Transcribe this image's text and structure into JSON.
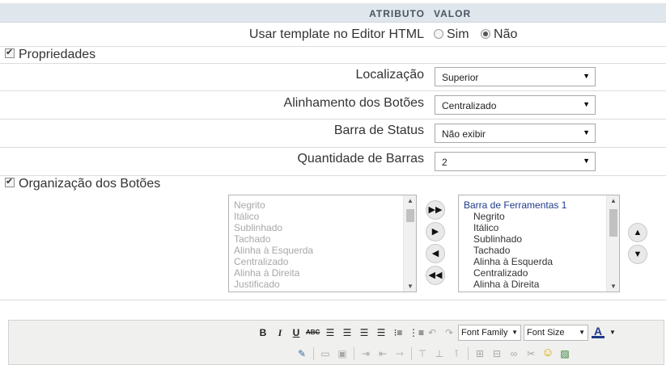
{
  "header": {
    "attr_label": "ATRIBUTO",
    "val_label": "VALOR"
  },
  "template_row": {
    "label": "Usar template no Editor HTML",
    "options": [
      {
        "label": "Sim",
        "selected": false
      },
      {
        "label": "Não",
        "selected": true
      }
    ]
  },
  "section_props": {
    "label": "Propriedades",
    "checked": true
  },
  "props": [
    {
      "label": "Localização",
      "value": "Superior"
    },
    {
      "label": "Alinhamento dos Botões",
      "value": "Centralizado"
    },
    {
      "label": "Barra de Status",
      "value": "Não exibir"
    },
    {
      "label": "Quantidade de Barras",
      "value": "2"
    }
  ],
  "section_org": {
    "label": "Organização dos Botões",
    "checked": true
  },
  "available_list": [
    "Negrito",
    "Itálico",
    "Sublinhado",
    "Tachado",
    "Alinha à Esquerda",
    "Centralizado",
    "Alinha à Direita",
    "Justificado"
  ],
  "selected_list": {
    "header": "Barra de Ferramentas 1",
    "items": [
      "Negrito",
      "Itálico",
      "Sublinhado",
      "Tachado",
      "Alinha à Esquerda",
      "Centralizado",
      "Alinha à Direita"
    ]
  },
  "transfer_buttons": [
    "move-all-right",
    "move-right",
    "move-left",
    "move-all-left"
  ],
  "order_buttons": [
    "move-up",
    "move-down"
  ],
  "editor_toolbar": {
    "bold": "B",
    "italic": "I",
    "underline": "U",
    "strike": "ABC",
    "font_family": "Font Family",
    "font_size": "Font Size",
    "font_color": "A"
  },
  "colors": {
    "header_bg": "#dfe6ec",
    "list_header": "#1f3a8a",
    "disabled": "#a8a8a8"
  }
}
